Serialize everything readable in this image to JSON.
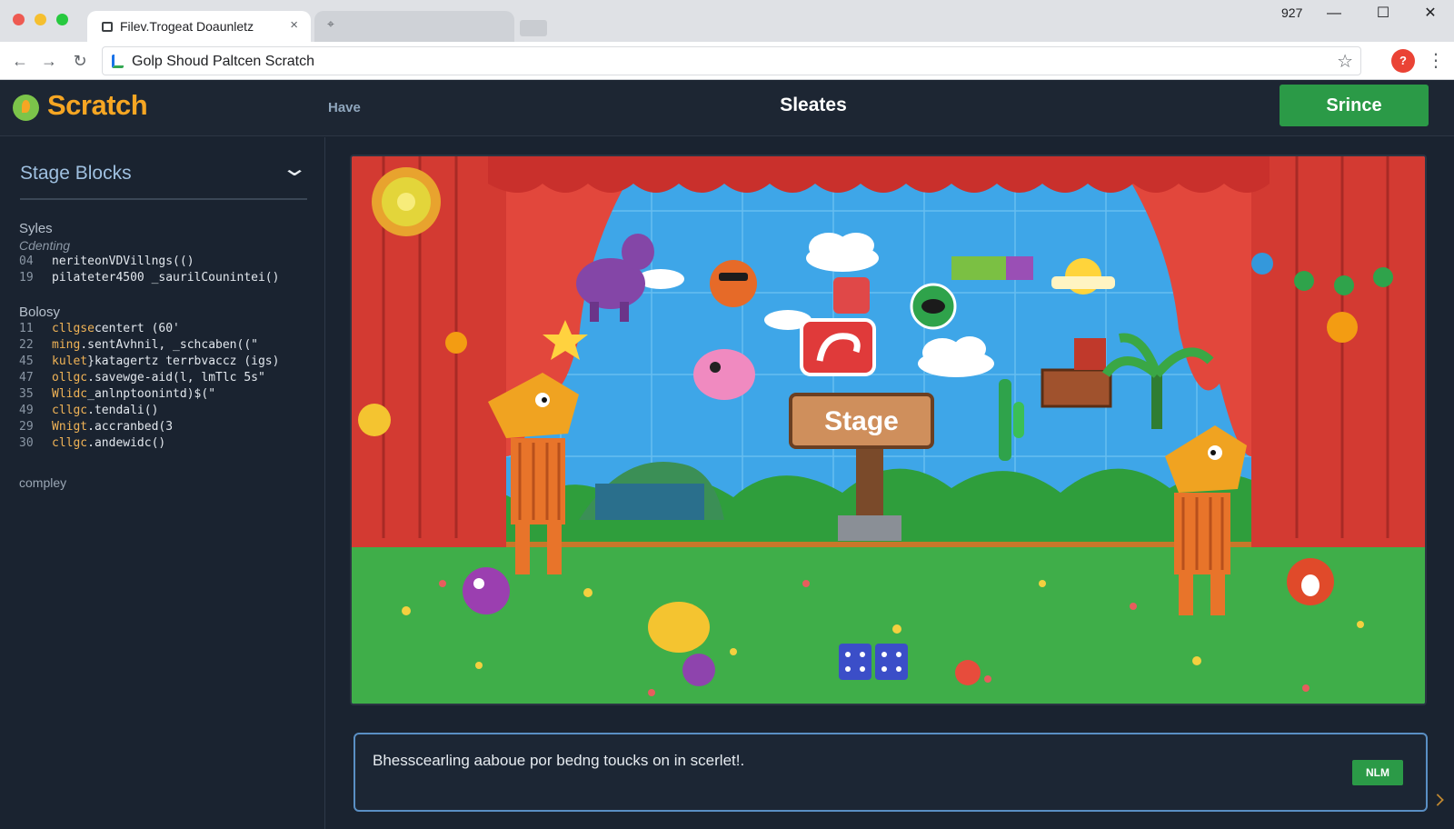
{
  "browser": {
    "tab_title": "Filev.Trogeat Doaunletz",
    "tab_close": "×",
    "new_tab_glyph": "⌖",
    "clock": "927",
    "url": "Golp Shoud Paltcen Scratch",
    "profile_initial": "?",
    "window_controls": {
      "minimize": "—",
      "maximize": "☐",
      "close": "✕"
    },
    "nav": {
      "back": "←",
      "forward": "→",
      "reload": "↻"
    },
    "bookmark_glyph": "☆",
    "menu_glyph": "⋮",
    "traffic_lights": [
      "#ee5a52",
      "#f5bf2f",
      "#27c93f"
    ]
  },
  "header": {
    "logo_text": "Scratch",
    "nav_item": "Have",
    "title": "Sleates",
    "cta_label": "Srince",
    "accent": "#f6a623",
    "cta_color": "#2b9a47"
  },
  "sidebar": {
    "title": "Stage Blocks",
    "chevron": "⌄",
    "sections": [
      {
        "label": "Syles",
        "sublabel": "Cdenting",
        "lines": [
          {
            "num": "04",
            "code": "neriteonVDVillngs(()"
          },
          {
            "num": "19",
            "code": "pilateter4500 _saurilCounintei()"
          }
        ]
      },
      {
        "label": "Bolosy",
        "lines": [
          {
            "num": "11",
            "kw": "cllgse",
            "code": "centert (60'"
          },
          {
            "num": "22",
            "kw": "ming",
            "code": ".sentAvhnil, _schcaben((\""
          },
          {
            "num": "45",
            "kw": "kulet",
            "code": "}katagertz terrbvaccz (igs)"
          },
          {
            "num": "47",
            "kw": "ollgc",
            "code": ".savewge-aid(l, lmTlc 5s\""
          },
          {
            "num": "35",
            "kw": "Wlidc",
            "code": "_anlnptoonintd)$(\""
          },
          {
            "num": "49",
            "kw": "cllgc",
            "code": ".tendali()"
          },
          {
            "num": "29",
            "kw": "Wnigt",
            "code": ".accranbed(3"
          },
          {
            "num": "30",
            "kw": "cllgc",
            "code": ".andewidc()"
          }
        ]
      }
    ],
    "footer_label": "compley"
  },
  "stage": {
    "sign_text": "Stage"
  },
  "message_bar": {
    "text": "Bhesscearling aaboue por bedng toucks on in scerlet!.",
    "button_label": "NLM"
  }
}
